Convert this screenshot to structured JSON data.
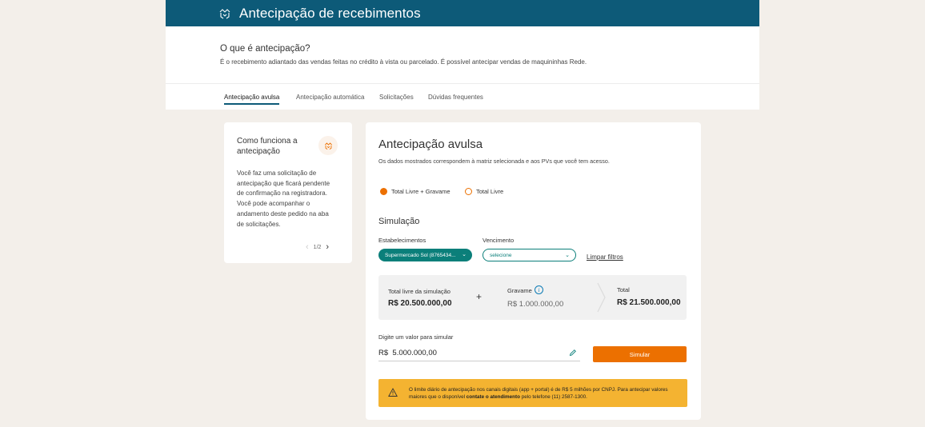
{
  "header": {
    "title": "Antecipação de recebimentos",
    "icon": "handshake-icon"
  },
  "info": {
    "question": "O que é antecipação?",
    "description": "É o recebimento adiantado das vendas feitas no crédito à vista ou parcelado. É possível antecipar vendas de maquininhas Rede."
  },
  "tabs": [
    {
      "label": "Antecipação avulsa",
      "active": true
    },
    {
      "label": "Antecipação automática",
      "active": false
    },
    {
      "label": "Solicitações",
      "active": false
    },
    {
      "label": "Dúvidas frequentes",
      "active": false
    }
  ],
  "how_it_works": {
    "title": "Como funciona a antecipação",
    "body": "Você faz uma solicitação de antecipação que ficará pendente de confirmação na registradora. Você pode acompanhar o andamento deste pedido na aba de solicitações.",
    "pager": "1/2"
  },
  "main": {
    "title": "Antecipação avulsa",
    "subtitle": "Os dados mostrados correspondem à matriz selecionada e aos PVs que você tem acesso.",
    "radio_options": [
      {
        "label": "Total Livre + Gravame",
        "selected": true
      },
      {
        "label": "Total Livre",
        "selected": false
      }
    ],
    "simulation_title": "Simulação",
    "filters": {
      "estab_label": "Estabelecimentos",
      "estab_value": "Supermercado Sol (8765434...",
      "venc_label": "Vencimento",
      "venc_value": "selecione",
      "clear_label": "Limpar filtros"
    },
    "summary": {
      "free_label": "Total livre da simulação",
      "free_value": "R$ 20.500.000,00",
      "plus": "+",
      "gravame_label": "Gravame",
      "gravame_value": "R$ 1.000.000,00",
      "total_label": "Total",
      "total_value": "R$ 21.500.000,00"
    },
    "input_label": "Digite um valor para simular",
    "input_value": "R$  5.000.000,00",
    "simulate_button": "Simular",
    "alert": {
      "text_start": "O limite diário de antecipação nos canais digitais (app + portal) é de R$ 5 milhões por CNPJ. Para antecipar valores maiores que o disponível ",
      "text_bold": "contate o atendimento",
      "text_end": " pelo telefone (11) 2587-1300."
    }
  },
  "colors": {
    "header": "#0d5a78",
    "accent": "#ec7000",
    "teal": "#0b7f7a",
    "alert": "#f4b331"
  }
}
